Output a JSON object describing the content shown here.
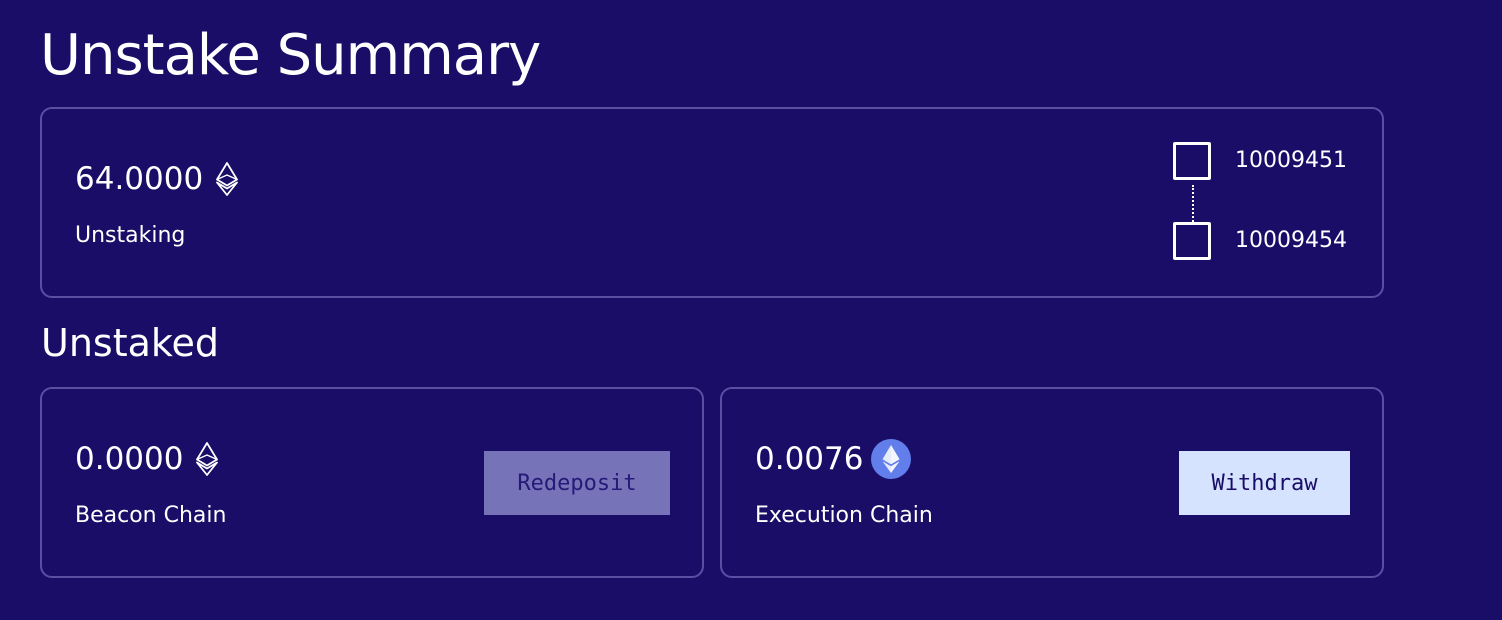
{
  "summary": {
    "title": "Unstake Summary",
    "unstaking": {
      "amount": "64.0000",
      "label": "Unstaking",
      "icon": "eth-outline-icon"
    },
    "validators": {
      "start_id": "10009451",
      "end_id": "10009454"
    }
  },
  "unstaked": {
    "title": "Unstaked",
    "beacon": {
      "amount": "0.0000",
      "label": "Beacon Chain",
      "icon": "eth-outline-icon",
      "button_label": "Redeposit"
    },
    "execution": {
      "amount": "0.0076",
      "label": "Execution Chain",
      "icon": "eth-badge-icon",
      "button_label": "Withdraw"
    }
  },
  "colors": {
    "background": "#190d68",
    "card_border": "#5a4fa2",
    "redeposit_button": "#7773b8",
    "withdraw_button": "#d6e3ff",
    "eth_badge": "#627eea"
  }
}
